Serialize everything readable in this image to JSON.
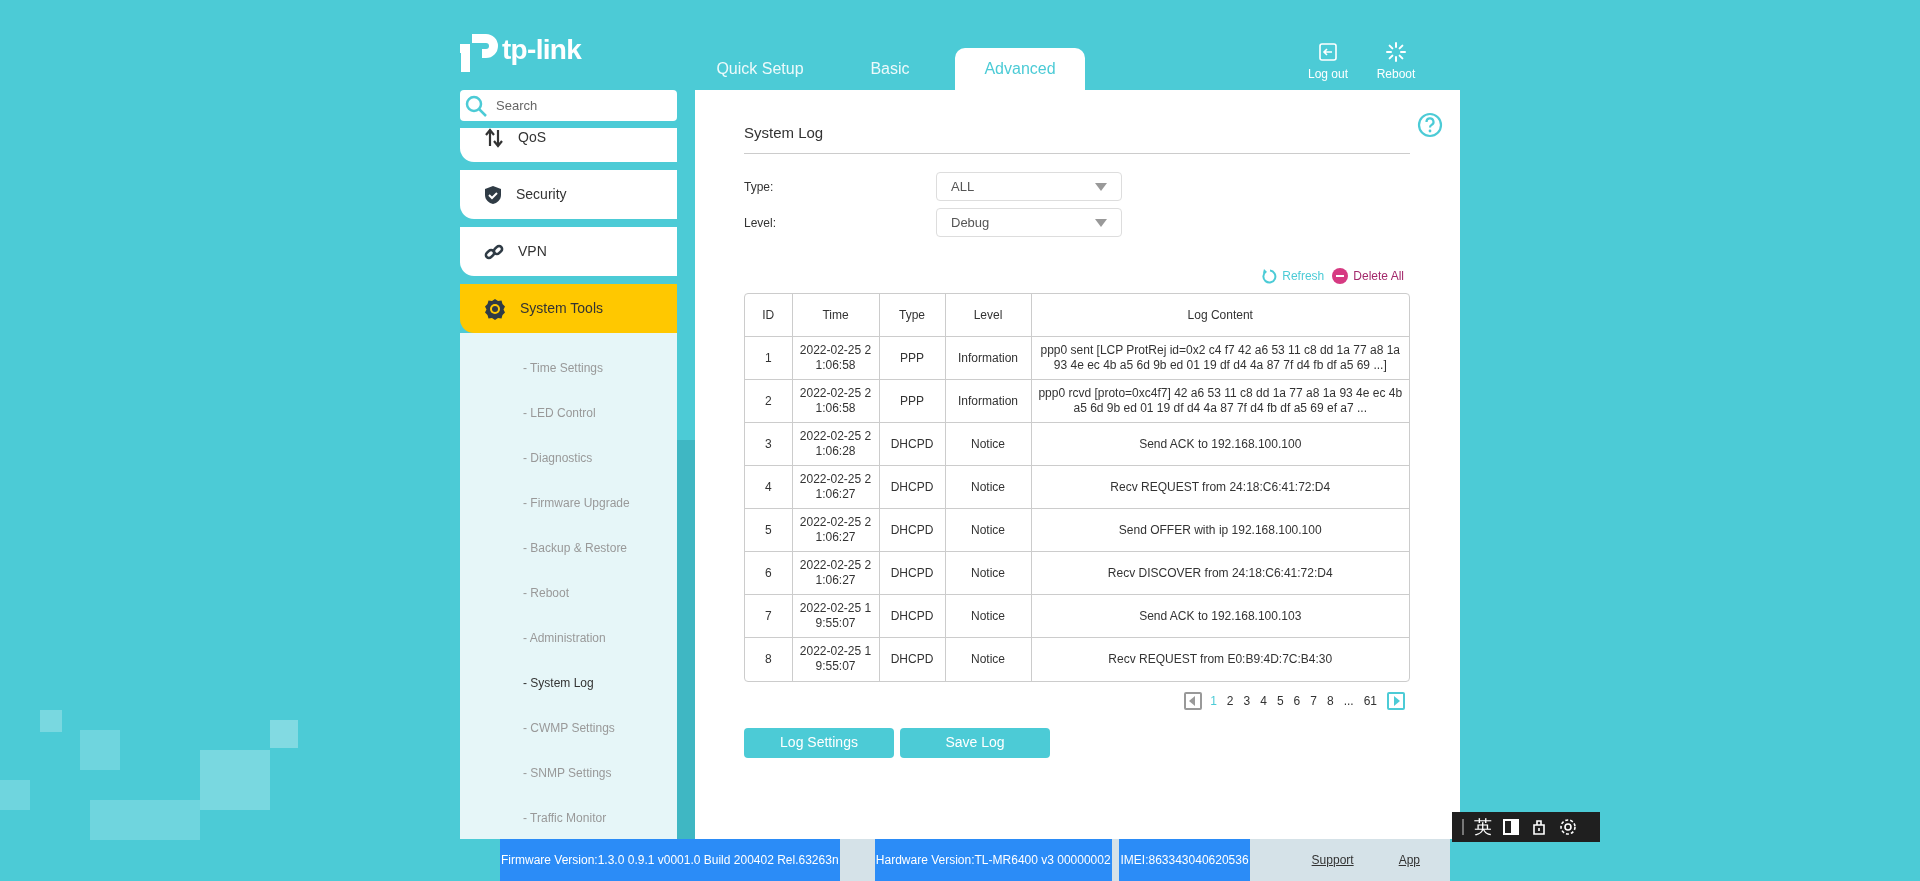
{
  "brand": "tp-link",
  "tabs": [
    {
      "label": "Quick Setup",
      "selected": false
    },
    {
      "label": "Basic",
      "selected": false
    },
    {
      "label": "Advanced",
      "selected": true
    }
  ],
  "header_actions": [
    {
      "kind": "logout",
      "label": "Log out"
    },
    {
      "kind": "reboot",
      "label": "Reboot"
    }
  ],
  "search": {
    "placeholder": "Search"
  },
  "sidebar": {
    "items": [
      {
        "kind": "qos",
        "label": "QoS",
        "selected": false
      },
      {
        "kind": "security",
        "label": "Security",
        "selected": false
      },
      {
        "kind": "vpn",
        "label": "VPN",
        "selected": false
      },
      {
        "kind": "tools",
        "label": "System Tools",
        "selected": true,
        "children": [
          {
            "label": "- Time Settings",
            "selected": false
          },
          {
            "label": "- LED Control",
            "selected": false
          },
          {
            "label": "- Diagnostics",
            "selected": false
          },
          {
            "label": "- Firmware Upgrade",
            "selected": false
          },
          {
            "label": "- Backup & Restore",
            "selected": false
          },
          {
            "label": "- Reboot",
            "selected": false
          },
          {
            "label": "- Administration",
            "selected": false
          },
          {
            "label": "- System Log",
            "selected": true
          },
          {
            "label": "- CWMP Settings",
            "selected": false
          },
          {
            "label": "- SNMP Settings",
            "selected": false
          },
          {
            "label": "- Traffic Monitor",
            "selected": false
          }
        ]
      }
    ]
  },
  "panel": {
    "title": "System Log",
    "filters": [
      {
        "label": "Type:",
        "value": "ALL"
      },
      {
        "label": "Level:",
        "value": "Debug"
      }
    ],
    "actions": [
      {
        "kind": "refresh",
        "label": "Refresh"
      },
      {
        "kind": "delete",
        "label": "Delete All"
      }
    ],
    "table": {
      "columns": [
        "ID",
        "Time",
        "Type",
        "Level",
        "Log Content"
      ],
      "rows": [
        [
          "1",
          "2022-02-25 21:06:58",
          "PPP",
          "Information",
          "ppp0 sent [LCP ProtRej id=0x2 c4 f7 42 a6 53 11 c8 dd 1a 77 a8 1a 93 4e ec 4b a5 6d 9b ed 01 19 df d4 4a 87 7f d4 fb df a5 69 ...]"
        ],
        [
          "2",
          "2022-02-25 21:06:58",
          "PPP",
          "Information",
          "ppp0 rcvd [proto=0xc4f7] 42 a6 53 11 c8 dd 1a 77 a8 1a 93 4e ec 4b a5 6d 9b ed 01 19 df d4 4a 87 7f d4 fb df a5 69 ef a7 ..."
        ],
        [
          "3",
          "2022-02-25 21:06:28",
          "DHCPD",
          "Notice",
          "Send ACK to 192.168.100.100"
        ],
        [
          "4",
          "2022-02-25 21:06:27",
          "DHCPD",
          "Notice",
          "Recv REQUEST from 24:18:C6:41:72:D4"
        ],
        [
          "5",
          "2022-02-25 21:06:27",
          "DHCPD",
          "Notice",
          "Send OFFER with ip 192.168.100.100"
        ],
        [
          "6",
          "2022-02-25 21:06:27",
          "DHCPD",
          "Notice",
          "Recv DISCOVER from 24:18:C6:41:72:D4"
        ],
        [
          "7",
          "2022-02-25 19:55:07",
          "DHCPD",
          "Notice",
          "Send ACK to 192.168.100.103"
        ],
        [
          "8",
          "2022-02-25 19:55:07",
          "DHCPD",
          "Notice",
          "Recv REQUEST from E0:B9:4D:7C:B4:30"
        ]
      ]
    },
    "pagination": {
      "prev_disabled": true,
      "pages": [
        {
          "label": "1",
          "selected": true
        },
        {
          "label": "2",
          "selected": false
        },
        {
          "label": "3",
          "selected": false
        },
        {
          "label": "4",
          "selected": false
        },
        {
          "label": "5",
          "selected": false
        },
        {
          "label": "6",
          "selected": false
        },
        {
          "label": "7",
          "selected": false
        },
        {
          "label": "8",
          "selected": false
        },
        {
          "label": "...",
          "selected": false
        },
        {
          "label": "61",
          "selected": false
        }
      ]
    },
    "buttons": [
      "Log Settings",
      "Save Log"
    ]
  },
  "footer": {
    "info": [
      "Firmware Version:1.3.0 0.9.1 v0001.0 Build 200402 Rel.63263n",
      "Hardware Version:TL-MR6400 v3 00000002",
      "IMEI:863343040620536"
    ],
    "links": [
      "Support",
      "App"
    ]
  },
  "ime_toolbar": {
    "label": "英"
  }
}
